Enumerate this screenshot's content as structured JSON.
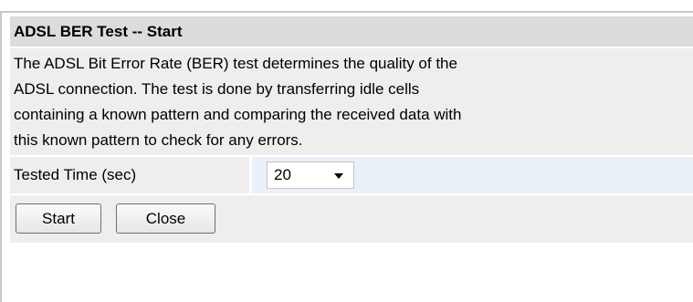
{
  "panel": {
    "title": "ADSL BER Test -- Start",
    "description_lines": [
      "The ADSL Bit Error Rate (BER) test determines the quality of the",
      "ADSL connection. The test is done by transferring idle cells",
      "containing a known pattern and comparing the received data with",
      "this known pattern to check for any errors."
    ],
    "tested_time": {
      "label": "Tested Time (sec)",
      "selected_value": "20"
    },
    "buttons": {
      "start_label": "Start",
      "close_label": "Close"
    }
  }
}
